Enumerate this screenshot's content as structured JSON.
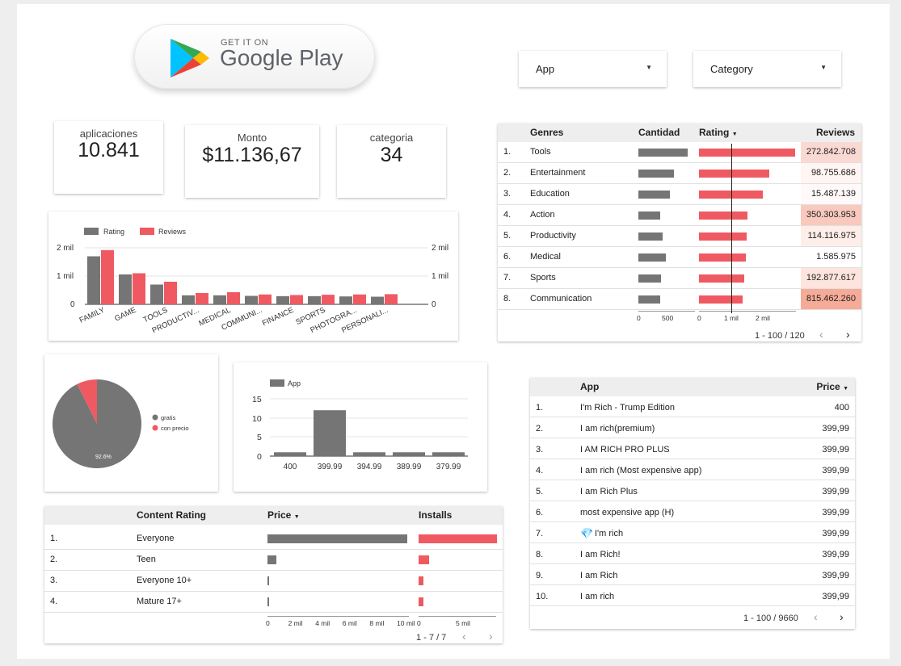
{
  "header": {
    "badge_top": "GET IT ON",
    "badge_main": "Google Play"
  },
  "filters": [
    {
      "label": "App"
    },
    {
      "label": "Category"
    }
  ],
  "kpis": [
    {
      "label": "aplicaciones",
      "value": "10.841"
    },
    {
      "label": "Monto",
      "value": "$11.136,67"
    },
    {
      "label": "categoria",
      "value": "34"
    }
  ],
  "category_chart": {
    "legend": [
      "Rating",
      "Reviews"
    ],
    "colors": [
      "#757575",
      "#ef5a62"
    ],
    "left_ticks": [
      "2 mil",
      "1 mil",
      "0"
    ],
    "right_ticks": [
      "2 mil",
      "1 mil",
      "0"
    ]
  },
  "genres_table": {
    "headers": {
      "genres": "Genres",
      "cantidad": "Cantidad",
      "rating": "Rating",
      "reviews": "Reviews"
    },
    "rows": [
      {
        "n": "1.",
        "genre": "Tools",
        "reviews": "272.842.708"
      },
      {
        "n": "2.",
        "genre": "Entertainment",
        "reviews": "98.755.686"
      },
      {
        "n": "3.",
        "genre": "Education",
        "reviews": "15.487.139"
      },
      {
        "n": "4.",
        "genre": "Action",
        "reviews": "350.303.953"
      },
      {
        "n": "5.",
        "genre": "Productivity",
        "reviews": "114.116.975"
      },
      {
        "n": "6.",
        "genre": "Medical",
        "reviews": "1.585.975"
      },
      {
        "n": "7.",
        "genre": "Sports",
        "reviews": "192.877.617"
      },
      {
        "n": "8.",
        "genre": "Communication",
        "reviews": "815.462.260"
      }
    ],
    "cantidad_values": [
      843,
      618,
      540,
      370,
      420,
      470,
      395,
      375
    ],
    "rating_values": [
      2490,
      1830,
      1670,
      1270,
      1230,
      1220,
      1170,
      1130
    ],
    "review_shades": [
      "#fbd9d3",
      "#fff5f3",
      "#fffaf9",
      "#f9c9bd",
      "#fdeee9",
      "#ffffff",
      "#fde4dd",
      "#f6ab98"
    ],
    "cantidad_axis": [
      "0",
      "500"
    ],
    "rating_axis": [
      "0",
      "1 mil",
      "2 mil"
    ],
    "pager": "1 - 100 / 120"
  },
  "pie": {
    "legend": [
      "gratis",
      "con precio"
    ],
    "colors": [
      "#757575",
      "#ef5a62"
    ],
    "label": "92.6%",
    "slices": [
      92.6,
      7.4
    ]
  },
  "price_chart": {
    "legend": "App",
    "color": "#757575",
    "y_ticks": [
      "15",
      "10",
      "5",
      "0"
    ],
    "ylim": [
      0,
      15
    ]
  },
  "content_table": {
    "headers": {
      "content": "Content Rating",
      "price": "Price",
      "installs": "Installs"
    },
    "rows": [
      {
        "n": "1.",
        "label": "Everyone"
      },
      {
        "n": "2.",
        "label": "Teen"
      },
      {
        "n": "3.",
        "label": "Everyone 10+"
      },
      {
        "n": "4.",
        "label": "Mature 17+"
      }
    ],
    "price_values": [
      10300,
      650,
      70,
      40
    ],
    "installs_values": [
      5.25,
      0.7,
      0.3,
      0.3
    ],
    "price_axis": [
      "0",
      "2 mil",
      "4 mil",
      "6 mil",
      "8 mil",
      "10 mil"
    ],
    "installs_axis": [
      "0",
      "5 mil"
    ],
    "pager": "1 - 7 / 7"
  },
  "app_table": {
    "headers": {
      "app": "App",
      "price": "Price"
    },
    "rows": [
      {
        "n": "1.",
        "app": "I'm Rich - Trump Edition",
        "price": "400"
      },
      {
        "n": "2.",
        "app": "I am rich(premium)",
        "price": "399,99"
      },
      {
        "n": "3.",
        "app": "I AM RICH PRO PLUS",
        "price": "399,99"
      },
      {
        "n": "4.",
        "app": "I am rich (Most expensive app)",
        "price": "399,99"
      },
      {
        "n": "5.",
        "app": "I am Rich Plus",
        "price": "399,99"
      },
      {
        "n": "6.",
        "app": "most expensive app (H)",
        "price": "399,99"
      },
      {
        "n": "7.",
        "app": "I'm rich",
        "price": "399,99"
      },
      {
        "n": "8.",
        "app": "I am Rich!",
        "price": "399,99"
      },
      {
        "n": "9.",
        "app": "I am Rich",
        "price": "399,99"
      },
      {
        "n": "10.",
        "app": "I am rich",
        "price": "399,99"
      }
    ],
    "pager": "1 - 100 / 9660"
  },
  "chart_data": [
    {
      "type": "bar",
      "categories": [
        "FAMILY",
        "GAME",
        "TOOLS",
        "PRODUCTIV...",
        "MEDICAL",
        "COMMUNI...",
        "FINANCE",
        "SPORTS",
        "PHOTOGRA...",
        "PERSONALI..."
      ],
      "series": [
        {
          "name": "Rating",
          "values": [
            1700,
            1060,
            700,
            320,
            320,
            300,
            290,
            290,
            280,
            270
          ]
        },
        {
          "name": "Reviews",
          "values": [
            1920,
            1100,
            800,
            400,
            430,
            350,
            330,
            340,
            350,
            360
          ]
        }
      ],
      "ylim": [
        0,
        2000
      ]
    },
    {
      "type": "pie",
      "categories": [
        "gratis",
        "con precio"
      ],
      "values": [
        92.6,
        7.4
      ]
    },
    {
      "type": "bar",
      "categories": [
        "400",
        "399.99",
        "394.99",
        "389.99",
        "379.99"
      ],
      "series": [
        {
          "name": "App",
          "values": [
            1,
            12,
            1,
            1,
            1
          ]
        }
      ],
      "ylim": [
        0,
        15
      ]
    }
  ]
}
